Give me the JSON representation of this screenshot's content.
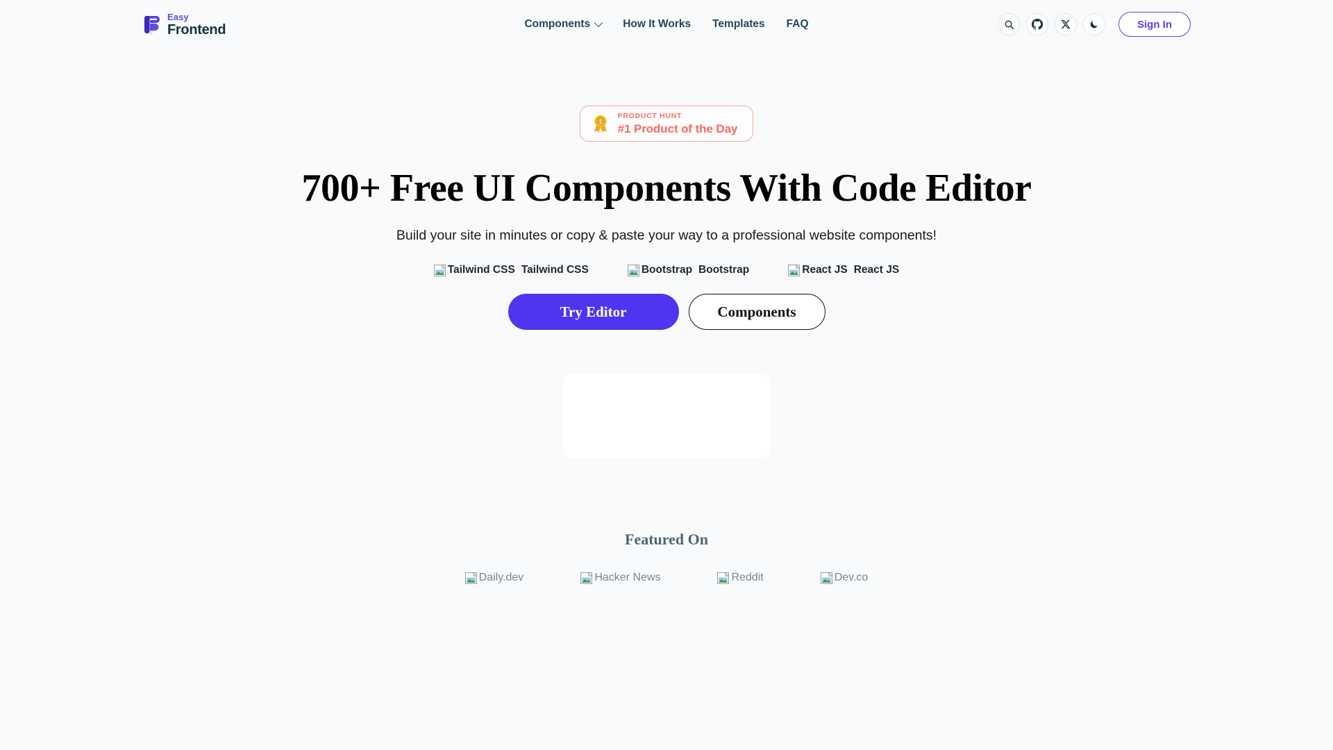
{
  "brand": {
    "logo_icon": "easyfrontend-logo-icon",
    "line1": "Easy",
    "line2": "Frontend"
  },
  "nav": {
    "items": [
      {
        "label": "Components",
        "has_dropdown": true,
        "icon": "chevron-down-icon"
      },
      {
        "label": "How It Works",
        "has_dropdown": false
      },
      {
        "label": "Templates",
        "has_dropdown": false
      },
      {
        "label": "FAQ",
        "has_dropdown": false
      }
    ]
  },
  "header_actions": {
    "icons": [
      {
        "name": "search-icon",
        "title": "Search"
      },
      {
        "name": "github-icon",
        "title": "GitHub"
      },
      {
        "name": "x-twitter-icon",
        "title": "X"
      },
      {
        "name": "dark-mode-moon-icon",
        "title": "Dark mode"
      }
    ],
    "sign_in_label": "Sign In"
  },
  "hero": {
    "badge": {
      "icon": "gold-medal-icon",
      "kicker": "PRODUCT HUNT",
      "title": "#1 Product of the Day"
    },
    "title": "700+ Free UI Components With Code Editor",
    "subtitle": "Build your site in minutes or copy & paste your way to a professional website components!",
    "tech": [
      {
        "alt": "Tailwind CSS",
        "label": "Tailwind CSS",
        "icon": "broken-image-icon"
      },
      {
        "alt": "Bootstrap",
        "label": "Bootstrap",
        "icon": "broken-image-icon"
      },
      {
        "alt": "React JS",
        "label": "React JS",
        "icon": "broken-image-icon"
      }
    ],
    "cta_primary": "Try Editor",
    "cta_secondary": "Components"
  },
  "featured": {
    "title": "Featured On",
    "logos": [
      {
        "alt": "Daily.dev",
        "icon": "broken-image-icon"
      },
      {
        "alt": "Hacker News",
        "icon": "broken-image-icon"
      },
      {
        "alt": "Reddit",
        "icon": "broken-image-icon"
      },
      {
        "alt": "Dev.co",
        "icon": "broken-image-icon"
      }
    ]
  },
  "colors": {
    "page_bg": "#f9fafb",
    "brand_purple": "#5b4ee5",
    "cta_purple": "#4f35ef",
    "nav_text": "#23475a",
    "product_hunt_red": "#fb6a5e",
    "featured_text": "#4f6670"
  }
}
